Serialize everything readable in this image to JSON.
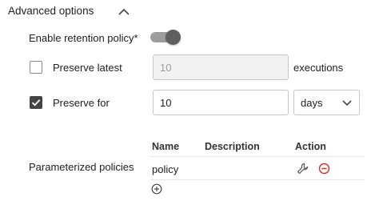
{
  "advanced": {
    "title": "Advanced options",
    "expand_icon": "chevron-up-icon"
  },
  "retention": {
    "label": "Enable retention policy*",
    "enabled": true
  },
  "preserve_latest": {
    "label": "Preserve latest",
    "checked": false,
    "value": "10",
    "suffix": "executions"
  },
  "preserve_for": {
    "label": "Preserve for",
    "checked": true,
    "value": "10",
    "unit_selected": "days"
  },
  "param_policies": {
    "label": "Parameterized policies",
    "columns": [
      "Name",
      "Description",
      "Action"
    ],
    "rows": [
      {
        "name": "policy",
        "description": "",
        "action_icons": [
          "wrench-icon",
          "remove-circle-icon"
        ]
      }
    ],
    "add_icon": "add-circle-icon"
  },
  "colors": {
    "remove_icon": "#d32f2f",
    "toggle_track": "#9e9e9e",
    "toggle_thumb": "#5f5f5f"
  }
}
